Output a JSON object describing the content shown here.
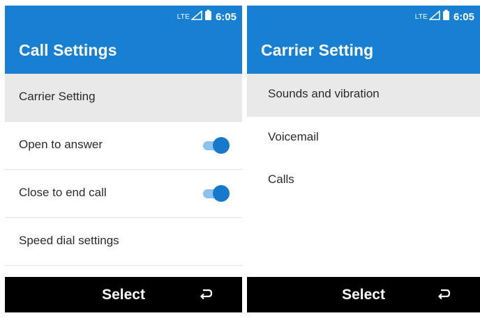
{
  "left_screen": {
    "status": {
      "network": "LTE",
      "time": "6:05"
    },
    "title": "Call Settings",
    "items": [
      {
        "label": "Carrier Setting",
        "selected": true
      },
      {
        "label": "Open to answer",
        "toggle": true
      },
      {
        "label": "Close to end call",
        "toggle": true
      },
      {
        "label": "Speed dial settings"
      }
    ],
    "softkeys": {
      "center": "Select",
      "right_icon": "back-icon"
    }
  },
  "right_screen": {
    "status": {
      "network": "LTE",
      "time": "6:05"
    },
    "title": "Carrier Setting",
    "items": [
      {
        "label": "Sounds and vibration",
        "selected": true
      },
      {
        "label": "Voicemail"
      },
      {
        "label": "Calls"
      }
    ],
    "softkeys": {
      "center": "Select",
      "right_icon": "back-icon"
    }
  },
  "colors": {
    "header_blue": "#1880d3",
    "toggle_thumb": "#1679cc",
    "toggle_track": "#8cc2ed",
    "selected_row": "#e9e9e9",
    "softkey_bar": "#000000"
  }
}
